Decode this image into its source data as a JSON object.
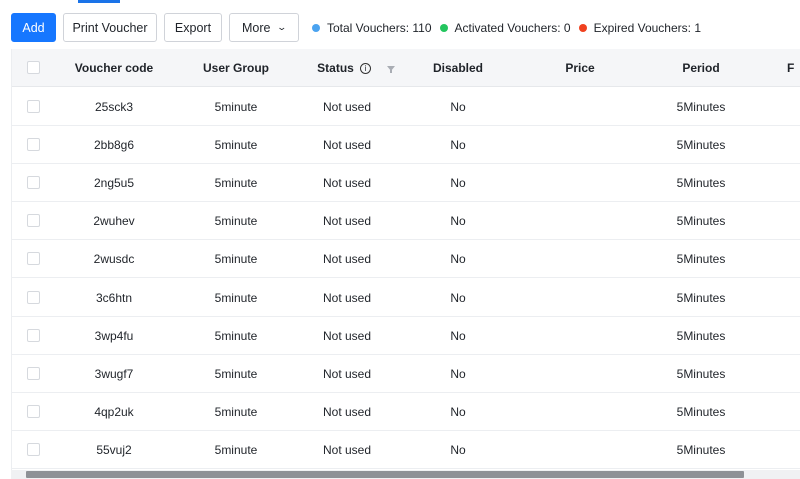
{
  "toolbar": {
    "add_label": "Add",
    "print_label": "Print Voucher",
    "export_label": "Export",
    "more_label": "More"
  },
  "stats": {
    "total": {
      "label": "Total Vouchers: 110",
      "color": "#4aa3f0"
    },
    "activated": {
      "label": "Activated Vouchers: 0",
      "color": "#23c55e"
    },
    "expired": {
      "label": "Expired Vouchers: 1",
      "color": "#f0411f"
    }
  },
  "table": {
    "columns": {
      "code": "Voucher code",
      "group": "User Group",
      "status": "Status",
      "disabled": "Disabled",
      "price": "Price",
      "period": "Period",
      "next": "F"
    },
    "rows": [
      {
        "code": "25sck3",
        "group": "5minute",
        "status": "Not used",
        "disabled": "No",
        "price": "",
        "period": "5Minutes"
      },
      {
        "code": "2bb8g6",
        "group": "5minute",
        "status": "Not used",
        "disabled": "No",
        "price": "",
        "period": "5Minutes"
      },
      {
        "code": "2ng5u5",
        "group": "5minute",
        "status": "Not used",
        "disabled": "No",
        "price": "",
        "period": "5Minutes"
      },
      {
        "code": "2wuhev",
        "group": "5minute",
        "status": "Not used",
        "disabled": "No",
        "price": "",
        "period": "5Minutes"
      },
      {
        "code": "2wusdc",
        "group": "5minute",
        "status": "Not used",
        "disabled": "No",
        "price": "",
        "period": "5Minutes"
      },
      {
        "code": "3c6htn",
        "group": "5minute",
        "status": "Not used",
        "disabled": "No",
        "price": "",
        "period": "5Minutes"
      },
      {
        "code": "3wp4fu",
        "group": "5minute",
        "status": "Not used",
        "disabled": "No",
        "price": "",
        "period": "5Minutes"
      },
      {
        "code": "3wugf7",
        "group": "5minute",
        "status": "Not used",
        "disabled": "No",
        "price": "",
        "period": "5Minutes"
      },
      {
        "code": "4qp2uk",
        "group": "5minute",
        "status": "Not used",
        "disabled": "No",
        "price": "",
        "period": "5Minutes"
      },
      {
        "code": "55vuj2",
        "group": "5minute",
        "status": "Not used",
        "disabled": "No",
        "price": "",
        "period": "5Minutes"
      }
    ]
  }
}
